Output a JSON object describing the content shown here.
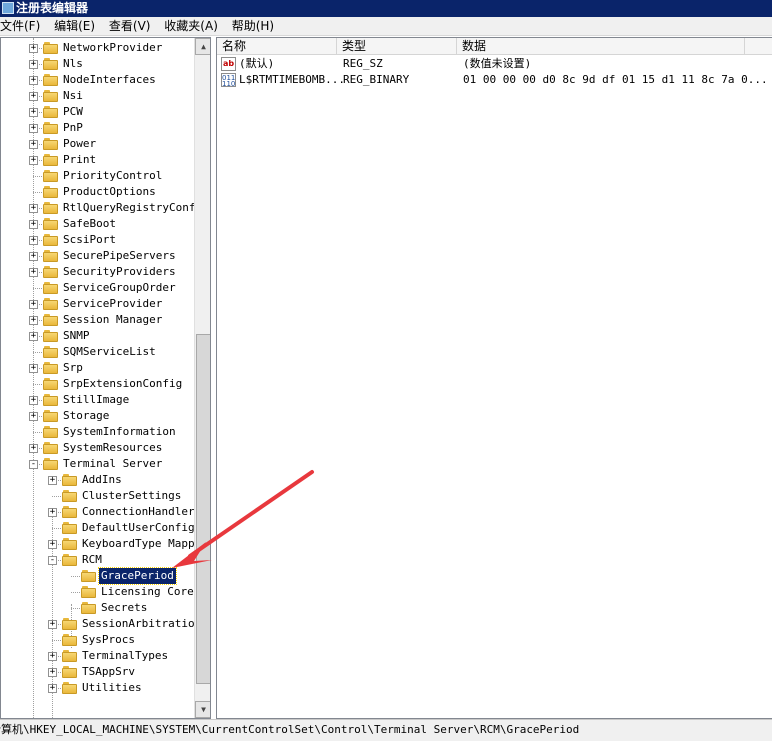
{
  "window": {
    "title": "注册表编辑器"
  },
  "menu": {
    "items": [
      "文件(F)",
      "编辑(E)",
      "查看(V)",
      "收藏夹(A)",
      "帮助(H)"
    ]
  },
  "tree": {
    "items": [
      {
        "label": "NetworkProvider",
        "level": 0,
        "expander": "+"
      },
      {
        "label": "Nls",
        "level": 0,
        "expander": "+"
      },
      {
        "label": "NodeInterfaces",
        "level": 0,
        "expander": "+"
      },
      {
        "label": "Nsi",
        "level": 0,
        "expander": "+"
      },
      {
        "label": "PCW",
        "level": 0,
        "expander": "+"
      },
      {
        "label": "PnP",
        "level": 0,
        "expander": "+"
      },
      {
        "label": "Power",
        "level": 0,
        "expander": "+"
      },
      {
        "label": "Print",
        "level": 0,
        "expander": "+"
      },
      {
        "label": "PriorityControl",
        "level": 0,
        "expander": ""
      },
      {
        "label": "ProductOptions",
        "level": 0,
        "expander": ""
      },
      {
        "label": "RtlQueryRegistryConfig",
        "level": 0,
        "expander": "+"
      },
      {
        "label": "SafeBoot",
        "level": 0,
        "expander": "+"
      },
      {
        "label": "ScsiPort",
        "level": 0,
        "expander": "+"
      },
      {
        "label": "SecurePipeServers",
        "level": 0,
        "expander": "+"
      },
      {
        "label": "SecurityProviders",
        "level": 0,
        "expander": "+"
      },
      {
        "label": "ServiceGroupOrder",
        "level": 0,
        "expander": ""
      },
      {
        "label": "ServiceProvider",
        "level": 0,
        "expander": "+"
      },
      {
        "label": "Session Manager",
        "level": 0,
        "expander": "+"
      },
      {
        "label": "SNMP",
        "level": 0,
        "expander": "+"
      },
      {
        "label": "SQMServiceList",
        "level": 0,
        "expander": ""
      },
      {
        "label": "Srp",
        "level": 0,
        "expander": "+"
      },
      {
        "label": "SrpExtensionConfig",
        "level": 0,
        "expander": ""
      },
      {
        "label": "StillImage",
        "level": 0,
        "expander": "+"
      },
      {
        "label": "Storage",
        "level": 0,
        "expander": "+"
      },
      {
        "label": "SystemInformation",
        "level": 0,
        "expander": ""
      },
      {
        "label": "SystemResources",
        "level": 0,
        "expander": "+"
      },
      {
        "label": "Terminal Server",
        "level": 0,
        "expander": "-"
      },
      {
        "label": "AddIns",
        "level": 1,
        "expander": "+"
      },
      {
        "label": "ClusterSettings",
        "level": 1,
        "expander": ""
      },
      {
        "label": "ConnectionHandler",
        "level": 1,
        "expander": "+"
      },
      {
        "label": "DefaultUserConfigur",
        "level": 1,
        "expander": ""
      },
      {
        "label": "KeyboardType Mappin",
        "level": 1,
        "expander": "+"
      },
      {
        "label": "RCM",
        "level": 1,
        "expander": "-"
      },
      {
        "label": "GracePeriod",
        "level": 2,
        "expander": "",
        "selected": true
      },
      {
        "label": "Licensing Core",
        "level": 2,
        "expander": ""
      },
      {
        "label": "Secrets",
        "level": 2,
        "expander": ""
      },
      {
        "label": "SessionArbitrationH",
        "level": 1,
        "expander": "+"
      },
      {
        "label": "SysProcs",
        "level": 1,
        "expander": ""
      },
      {
        "label": "TerminalTypes",
        "level": 1,
        "expander": "+"
      },
      {
        "label": "TSAppSrv",
        "level": 1,
        "expander": "+"
      },
      {
        "label": "Utilities",
        "level": 1,
        "expander": "+"
      }
    ]
  },
  "list": {
    "columns": [
      "名称",
      "类型",
      "数据"
    ],
    "rows": [
      {
        "icon": "string-value-icon",
        "name": "(默认)",
        "type": "REG_SZ",
        "data": "(数值未设置)"
      },
      {
        "icon": "binary-value-icon",
        "name": "L$RTMTIMEBOMB...",
        "type": "REG_BINARY",
        "data": "01 00 00 00 d0 8c 9d df 01 15 d1 11 8c 7a 0..."
      }
    ]
  },
  "status": {
    "path": "计算机\\HKEY_LOCAL_MACHINE\\SYSTEM\\CurrentControlSet\\Control\\Terminal Server\\RCM\\GracePeriod"
  },
  "colors": {
    "title_bg": "#0a246a",
    "selection_bg": "#0a246a",
    "arrow": "#e8383d",
    "folder": "#f2c94c"
  }
}
